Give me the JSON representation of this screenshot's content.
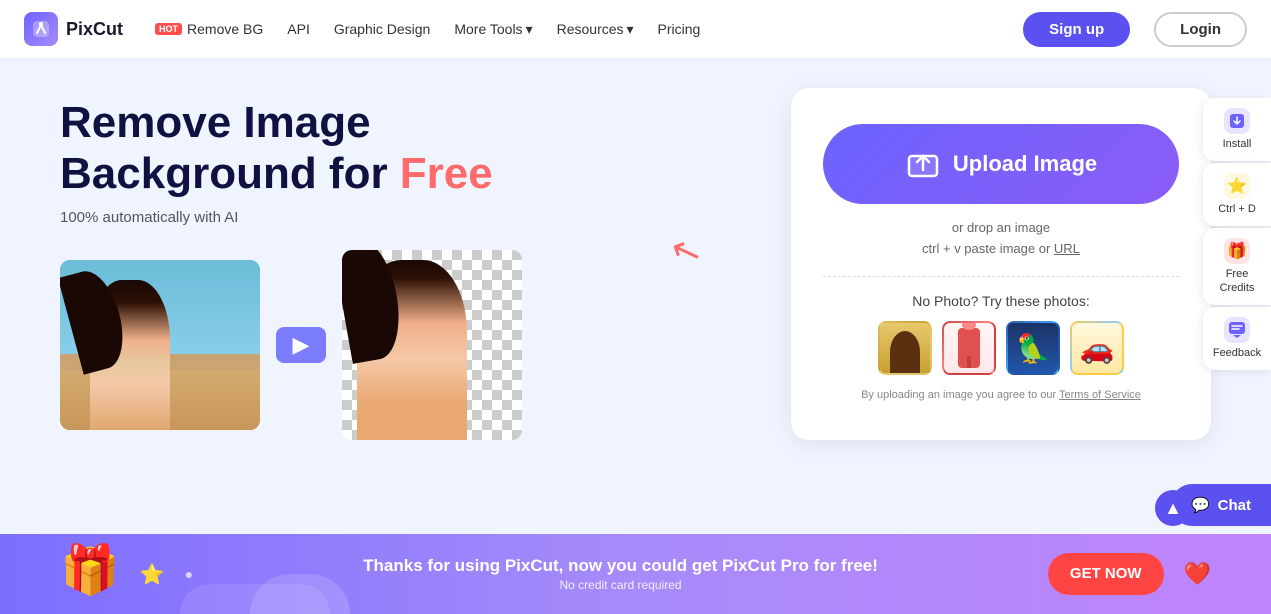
{
  "navbar": {
    "logo_text": "PixCut",
    "remove_bg_label": "Remove BG",
    "remove_bg_badge": "HOT",
    "api_label": "API",
    "graphic_design_label": "Graphic Design",
    "more_tools_label": "More Tools",
    "resources_label": "Resources",
    "pricing_label": "Pricing",
    "signup_label": "Sign up",
    "login_label": "Login"
  },
  "hero": {
    "title_line1": "Remove Image",
    "title_line2": "Background for ",
    "title_free": "Free",
    "subtitle": "100% automatically with AI"
  },
  "upload_card": {
    "upload_button_label": "Upload Image",
    "or_drop_label": "or drop an image",
    "ctrl_v_label": "ctrl + v paste image or",
    "url_label": "URL",
    "try_photos_label": "No Photo? Try these photos:",
    "terms_prefix": "By uploading an image you agree to our ",
    "terms_link": "Terms of Service"
  },
  "float_panel": {
    "install_label": "Install",
    "bookmark_label": "Ctrl + D",
    "free_credits_label": "Free Credits",
    "feedback_label": "Feedback"
  },
  "bottom_banner": {
    "main_text": "Thanks for using PixCut, now you could get PixCut Pro for free!",
    "sub_text": "No credit card required",
    "cta_label": "GET NOW"
  },
  "chat_button": {
    "label": "Chat"
  },
  "sample_photos": [
    {
      "id": "photo-1",
      "label": "Person with yellow hat"
    },
    {
      "id": "photo-2",
      "label": "Drink with straw"
    },
    {
      "id": "photo-3",
      "label": "Blue bird"
    },
    {
      "id": "photo-4",
      "label": "Yellow car"
    }
  ]
}
